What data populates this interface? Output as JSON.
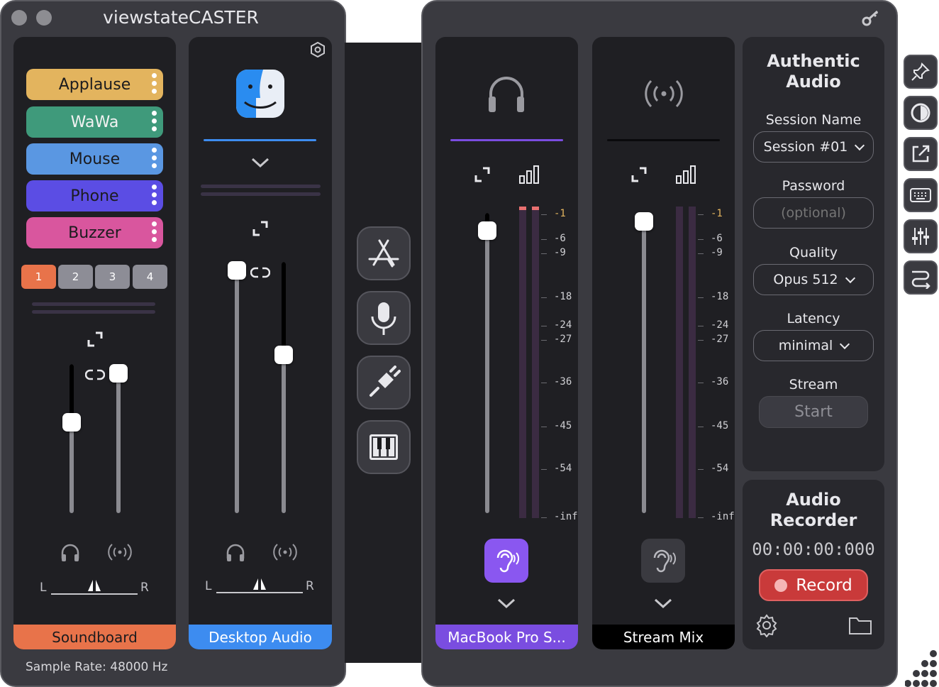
{
  "app": {
    "title": "viewstateCASTER",
    "sample_rate": "Sample Rate: 48000 Hz"
  },
  "soundboard": {
    "label": "Soundboard",
    "buttons": [
      {
        "label": "Applause",
        "color": "#e3b45e"
      },
      {
        "label": "WaWa",
        "color": "#3f9a7b"
      },
      {
        "label": "Mouse",
        "color": "#5a97e2"
      },
      {
        "label": "Phone",
        "color": "#5b4de4"
      },
      {
        "label": "Buzzer",
        "color": "#d9569e"
      }
    ],
    "pages": [
      "1",
      "2",
      "3",
      "4"
    ],
    "active_page": "1",
    "label_color": "#e8734a"
  },
  "desktop": {
    "label": "Desktop Audio",
    "label_color": "#3d8cf0",
    "app_icon": "finder-icon"
  },
  "pan": {
    "left": "L",
    "right": "R"
  },
  "tools": [
    "app-store-icon",
    "microphone-icon",
    "plug-icon",
    "piano-icon"
  ],
  "macbook": {
    "label": "MacBook Pro S...",
    "label_color": "#7a4de0",
    "listen_active_color": "#8a57f0"
  },
  "streammix": {
    "label": "Stream Mix"
  },
  "meter_ticks": [
    "-1",
    "-6",
    "-9",
    "-18",
    "-24",
    "-27",
    "-36",
    "-45",
    "-54",
    "-inf"
  ],
  "authentic": {
    "title_line1": "Authentic",
    "title_line2": "Audio",
    "session_label": "Session Name",
    "session_value": "Session #01",
    "password_label": "Password",
    "password_placeholder": "(optional)",
    "quality_label": "Quality",
    "quality_value": "Opus 512",
    "latency_label": "Latency",
    "latency_value": "minimal",
    "stream_label": "Stream",
    "start_label": "Start"
  },
  "recorder": {
    "title_line1": "Audio",
    "title_line2": "Recorder",
    "time": "00:00:00:000",
    "record_label": "Record",
    "record_color": "#d93a3a"
  },
  "side_tools": [
    "pin-icon",
    "contrast-icon",
    "popout-icon",
    "keyboard-icon",
    "mixer-sliders-icon",
    "route-icon"
  ]
}
